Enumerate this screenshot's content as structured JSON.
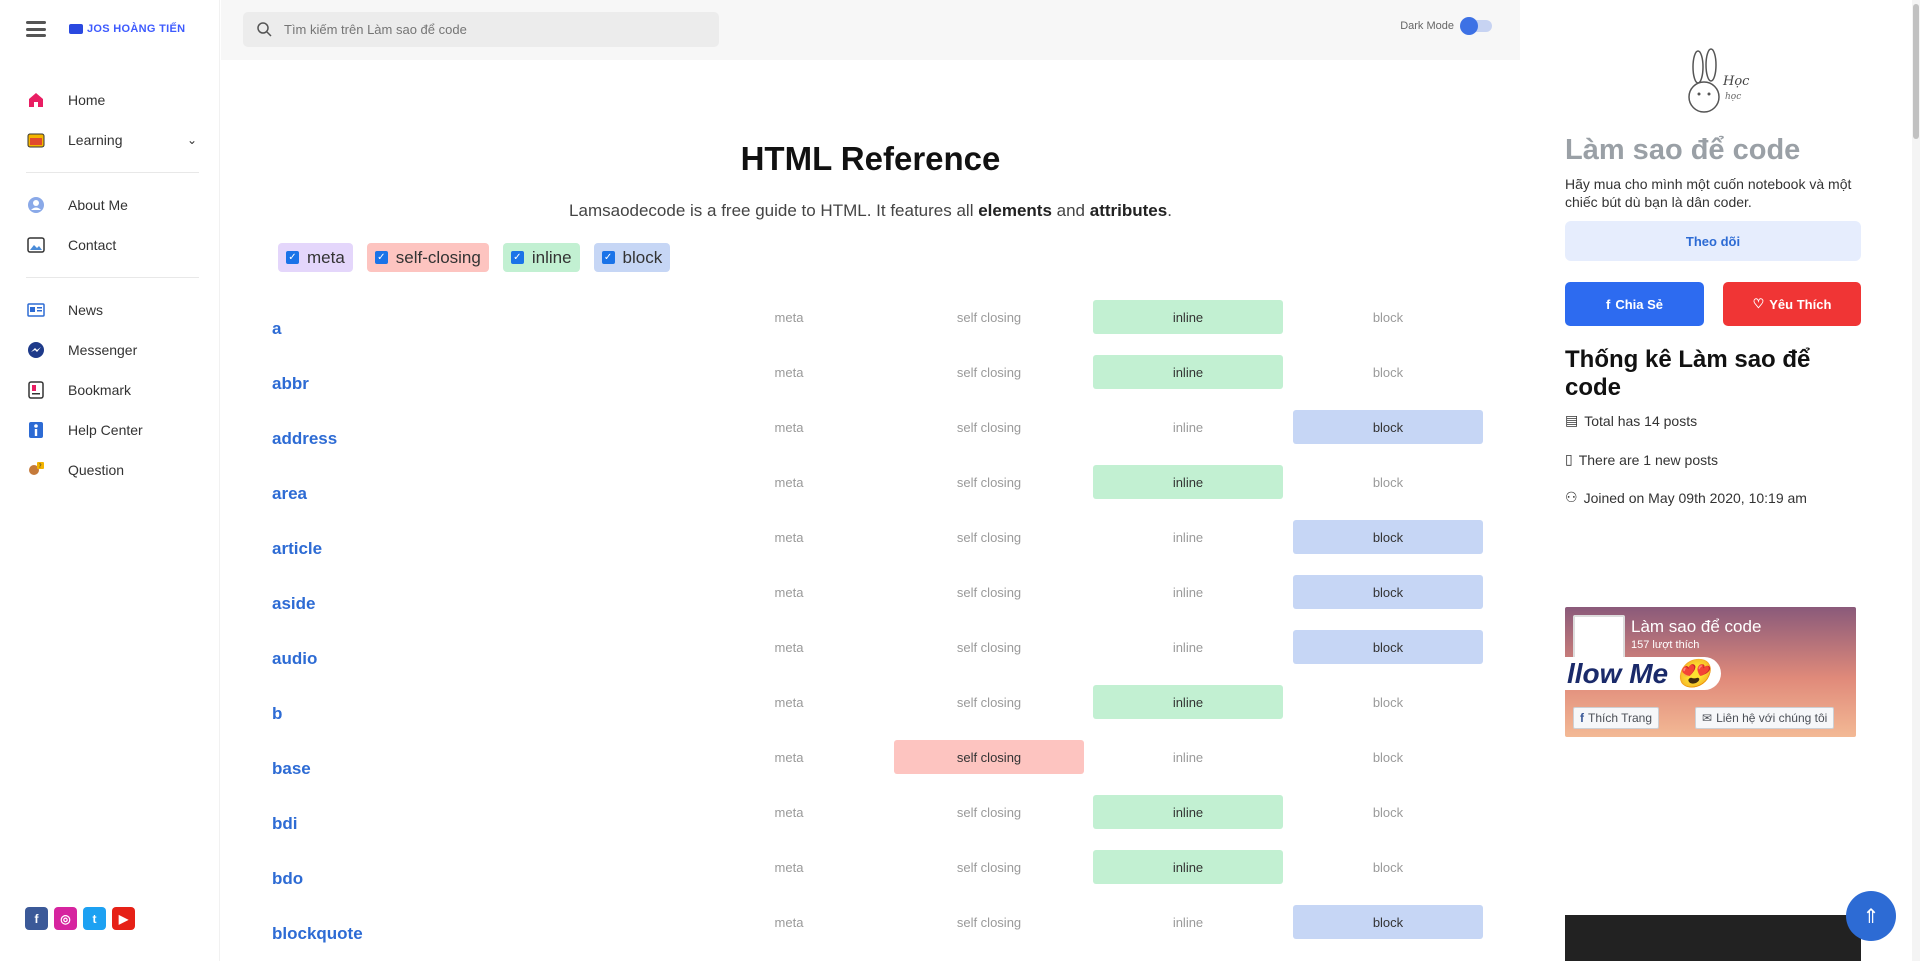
{
  "sidebar": {
    "logo_text": "JOS HOÀNG TIẾN",
    "items": [
      {
        "label": "Home",
        "icon": "home-icon"
      },
      {
        "label": "Learning",
        "icon": "folder-icon"
      },
      {
        "label": "About Me",
        "icon": "user-icon"
      },
      {
        "label": "Contact",
        "icon": "picture-icon"
      },
      {
        "label": "News",
        "icon": "newspaper-icon"
      },
      {
        "label": "Messenger",
        "icon": "messenger-icon"
      },
      {
        "label": "Bookmark",
        "icon": "bookmark-icon"
      },
      {
        "label": "Help Center",
        "icon": "info-icon"
      },
      {
        "label": "Question",
        "icon": "question-icon"
      }
    ],
    "socials": [
      "facebook-icon",
      "instagram-icon",
      "twitter-icon",
      "youtube-icon"
    ]
  },
  "topbar": {
    "search_placeholder": "Tìm kiếm trên Làm sao để code",
    "dark_mode_label": "Dark Mode"
  },
  "main": {
    "title": "HTML Reference",
    "intro_prefix": "Lamsaodecode is a free guide to HTML. It features all ",
    "intro_bold1": "elements",
    "intro_mid": " and ",
    "intro_bold2": "attributes",
    "intro_suffix": ".",
    "filters": [
      {
        "label": "meta",
        "checked": true,
        "color": "#e4d6fb"
      },
      {
        "label": "self-closing",
        "checked": true,
        "color": "#fdc4c0"
      },
      {
        "label": "inline",
        "checked": true,
        "color": "#c2f0d2"
      },
      {
        "label": "block",
        "checked": true,
        "color": "#c6d6f5"
      }
    ],
    "cell_labels": {
      "meta": "meta",
      "self": "self closing",
      "inline": "inline",
      "block": "block"
    },
    "elements": [
      {
        "name": "a",
        "type": "inline"
      },
      {
        "name": "abbr",
        "type": "inline"
      },
      {
        "name": "address",
        "type": "block"
      },
      {
        "name": "area",
        "type": "inline"
      },
      {
        "name": "article",
        "type": "block"
      },
      {
        "name": "aside",
        "type": "block"
      },
      {
        "name": "audio",
        "type": "block"
      },
      {
        "name": "b",
        "type": "inline"
      },
      {
        "name": "base",
        "type": "self"
      },
      {
        "name": "bdi",
        "type": "inline"
      },
      {
        "name": "bdo",
        "type": "inline"
      },
      {
        "name": "blockquote",
        "type": "block"
      }
    ]
  },
  "right": {
    "site_name": "Làm sao để code",
    "tagline": "Hãy mua cho mình một cuốn notebook và một chiếc bút dù bạn là dân coder.",
    "follow_label": "Theo dõi",
    "share_label": "Chia Sẻ",
    "like_label": "Yêu Thích",
    "stats_title": "Thống kê Làm sao để code",
    "stats": [
      {
        "text": "Total has 14 posts",
        "icon": "document-icon"
      },
      {
        "text": "There are 1 new posts",
        "icon": "file-icon"
      },
      {
        "text": "Joined on May 09th 2020, 10:19 am",
        "icon": "user-add-icon"
      }
    ],
    "fb_widget": {
      "page_name": "Làm sao để code",
      "likes": "157 lượt thích",
      "banner_text": "llow Me 😍",
      "like_page": "Thích Trang",
      "contact": "Liên hệ với chúng tôi"
    }
  },
  "colors": {
    "accent": "#2d6bd4",
    "share": "#2d6bf0",
    "like": "#f03535"
  }
}
